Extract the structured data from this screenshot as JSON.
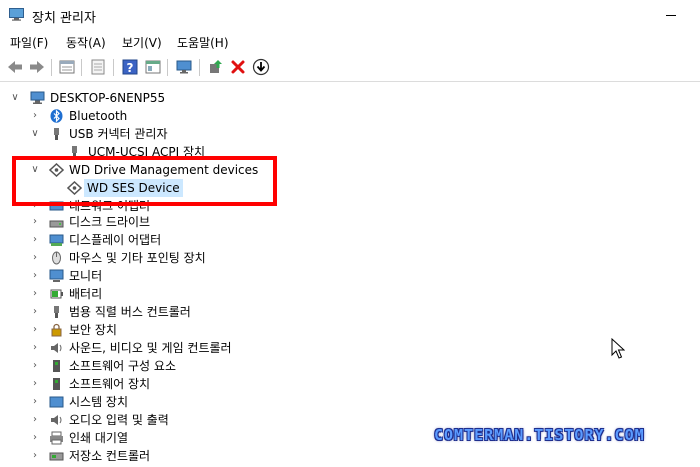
{
  "window": {
    "title": "장치 관리자"
  },
  "menu": [
    {
      "label": "파일(F)"
    },
    {
      "label": "동작(A)"
    },
    {
      "label": "보기(V)"
    },
    {
      "label": "도움말(H)"
    }
  ],
  "toolbar": {
    "icons": [
      "back-arrow-icon",
      "forward-arrow-icon",
      "properties-icon",
      "show-hidden-icon",
      "help-icon",
      "view-icon",
      "monitor-icon",
      "update-driver-icon",
      "uninstall-icon",
      "scan-hardware-icon"
    ]
  },
  "tree": {
    "root": "DESKTOP-6NENP55",
    "items": [
      {
        "label": "Bluetooth",
        "expanded": false
      },
      {
        "label": "USB 커넥터 관리자",
        "expanded": true
      },
      {
        "label": "UCM-UCSI ACPI 장치",
        "child": true
      },
      {
        "label": "WD Drive Management devices",
        "expanded": true
      },
      {
        "label": "WD SES Device",
        "child": true,
        "selected": true
      },
      {
        "label": "네트워크 어댑터",
        "expanded": false
      },
      {
        "label": "디스크 드라이브",
        "expanded": false
      },
      {
        "label": "디스플레이 어댑터",
        "expanded": false
      },
      {
        "label": "마우스 및 기타 포인팅 장치",
        "expanded": false
      },
      {
        "label": "모니터",
        "expanded": false
      },
      {
        "label": "배터리",
        "expanded": false
      },
      {
        "label": "범용 직렬 버스 컨트롤러",
        "expanded": false
      },
      {
        "label": "보안 장치",
        "expanded": false
      },
      {
        "label": "사운드, 비디오 및 게임 컨트롤러",
        "expanded": false
      },
      {
        "label": "소프트웨어 구성 요소",
        "expanded": false
      },
      {
        "label": "소프트웨어 장치",
        "expanded": false
      },
      {
        "label": "시스템 장치",
        "expanded": false
      },
      {
        "label": "오디오 입력 및 출력",
        "expanded": false
      },
      {
        "label": "인쇄 대기열",
        "expanded": false
      },
      {
        "label": "저장소 컨트롤러",
        "expanded": false
      }
    ]
  },
  "watermark": "COMTERMAN.TISTORY.COM",
  "colors": {
    "highlight": "#ff0000",
    "selection": "#cce8ff",
    "watermark": "#5b9bff"
  }
}
